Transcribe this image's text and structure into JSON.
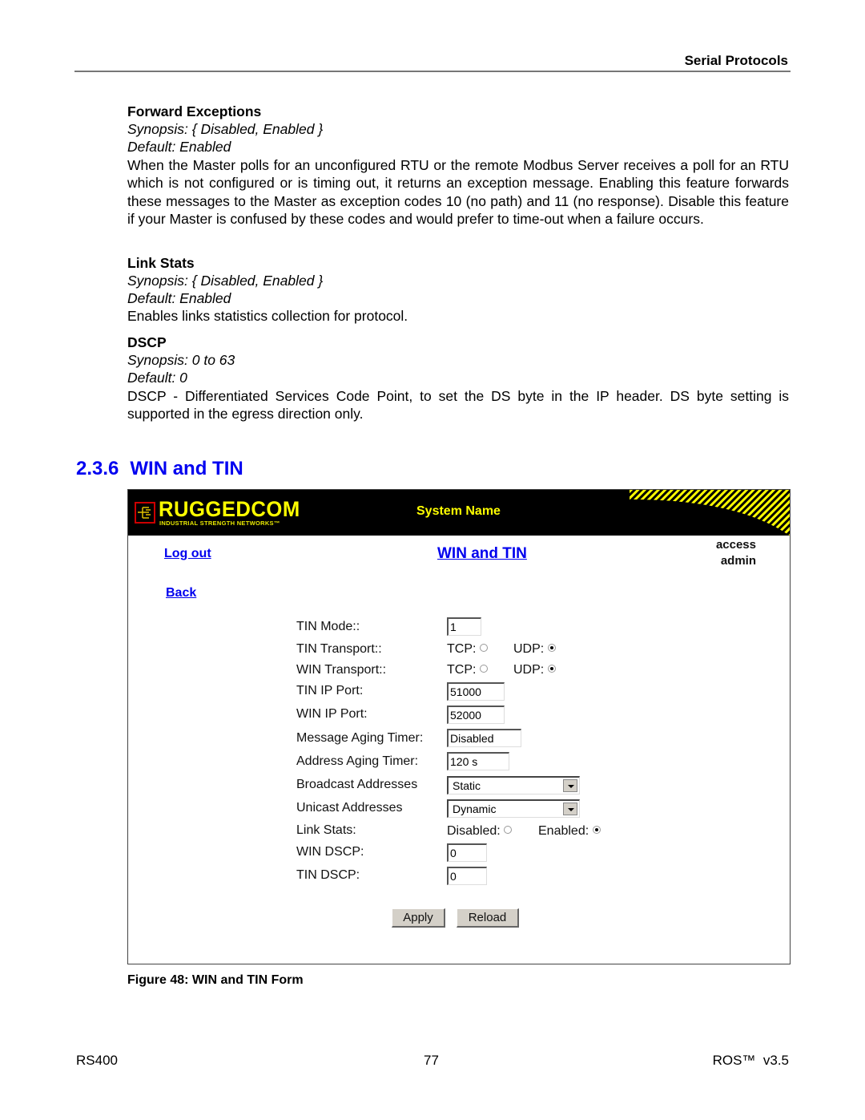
{
  "header": {
    "section": "Serial Protocols"
  },
  "params": [
    {
      "name": "Forward Exceptions",
      "synopsis": "Synopsis: { Disabled, Enabled }",
      "default": "Default: Enabled",
      "description": "When the Master polls for an unconfigured RTU or the remote Modbus Server receives a poll for an RTU which is not configured or is timing out, it returns an exception message. Enabling this feature forwards these messages to the Master as exception codes 10 (no path) and 11 (no response). Disable this feature if your Master is confused by these codes and would prefer to time-out when a failure occurs."
    },
    {
      "name": "Link Stats",
      "synopsis": "Synopsis: { Disabled, Enabled }",
      "default": "Default: Enabled",
      "description": "Enables links statistics collection for protocol."
    },
    {
      "name": "DSCP",
      "synopsis": "Synopsis: 0 to 63",
      "default": "Default: 0",
      "description": "DSCP - Differentiated Services Code Point, to set the DS byte in the IP header. DS byte setting is supported in the egress direction only."
    }
  ],
  "section": {
    "number": "2.3.6",
    "title": "WIN and TIN"
  },
  "figure": {
    "banner": {
      "logo": "RUGGEDCOM",
      "logo_sub": "INDUSTRIAL STRENGTH NETWORKS™",
      "system_name": "System Name"
    },
    "nav": {
      "logout": "Log out",
      "back": "Back"
    },
    "page_title": "WIN and TIN",
    "access": {
      "label": "access",
      "user": "admin"
    },
    "form": {
      "tin_mode": {
        "label": "TIN Mode::",
        "value": "1"
      },
      "tin_transport": {
        "label": "TIN Transport::",
        "opt1": "TCP:",
        "opt2": "UDP:",
        "selected": "UDP"
      },
      "win_transport": {
        "label": "WIN Transport::",
        "opt1": "TCP:",
        "opt2": "UDP:",
        "selected": "UDP"
      },
      "tin_ip_port": {
        "label": "TIN IP Port:",
        "value": "51000"
      },
      "win_ip_port": {
        "label": "WIN IP Port:",
        "value": "52000"
      },
      "msg_aging": {
        "label": "Message Aging Timer:",
        "value": "Disabled"
      },
      "addr_aging": {
        "label": "Address Aging Timer:",
        "value": "120 s"
      },
      "broadcast": {
        "label": "Broadcast Addresses",
        "value": "Static"
      },
      "unicast": {
        "label": "Unicast Addresses",
        "value": "Dynamic"
      },
      "link_stats": {
        "label": "Link Stats:",
        "opt1": "Disabled:",
        "opt2": "Enabled:",
        "selected": "Enabled"
      },
      "win_dscp": {
        "label": "WIN DSCP:",
        "value": "0"
      },
      "tin_dscp": {
        "label": "TIN DSCP:",
        "value": "0"
      },
      "apply": "Apply",
      "reload": "Reload"
    },
    "caption": "Figure 48: WIN and TIN Form"
  },
  "footer": {
    "left": "RS400",
    "center": "77",
    "right": "ROS™  v3.5"
  }
}
